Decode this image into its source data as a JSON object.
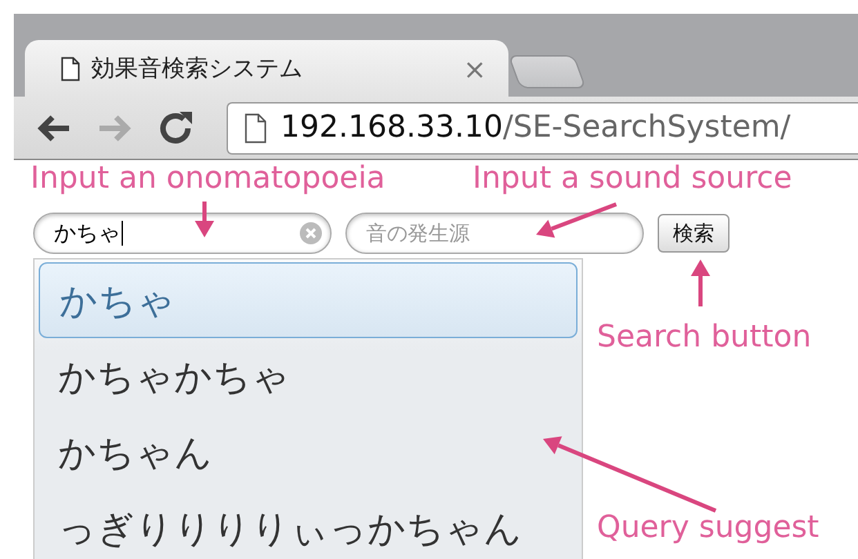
{
  "browser": {
    "tabs": [
      {
        "title": "効果音検索システム",
        "close": "×",
        "selected": true
      },
      {
        "selected": false
      }
    ],
    "address": {
      "host": "192.168.33.10",
      "path": "/SE-SearchSystem/"
    }
  },
  "form": {
    "query_field": {
      "value": "かちゃ"
    },
    "source_field": {
      "placeholder": "音の発生源"
    },
    "search_button": "検索"
  },
  "suggestions": [
    {
      "text": "かちゃ",
      "selected": true
    },
    {
      "text": "かちゃかちゃ",
      "selected": false
    },
    {
      "text": "かちゃん",
      "selected": false
    },
    {
      "text": "っぎりりりりぃっかちゃん",
      "selected": false
    }
  ],
  "annotations": [
    {
      "text": "Input an onomatopoeia"
    },
    {
      "text": "Input a sound source"
    },
    {
      "text": "Search button"
    },
    {
      "text": "Query suggest"
    }
  ]
}
